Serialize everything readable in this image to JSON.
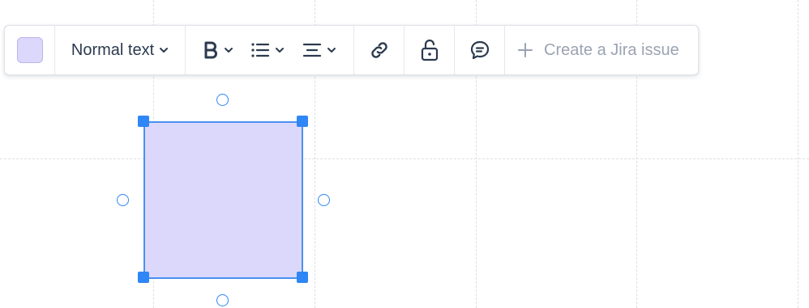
{
  "toolbar": {
    "color_swatch": {
      "icon": "color-swatch",
      "color": "#dcd8fb"
    },
    "text_style": {
      "label": "Normal text",
      "icon": "chevron-down-icon"
    },
    "bold": {
      "icon": "bold-icon"
    },
    "list": {
      "icon": "bulleted-list-icon"
    },
    "align": {
      "icon": "text-align-icon"
    },
    "link": {
      "icon": "link-icon"
    },
    "lock": {
      "icon": "unlocked-icon"
    },
    "comment": {
      "icon": "comment-icon"
    },
    "create_issue": {
      "label": "Create a Jira issue",
      "icon": "plus-icon"
    }
  },
  "canvas": {
    "shape": {
      "type": "rectangle",
      "fill": "#dcd8fb",
      "stroke": "#4a90f0",
      "selected": true
    },
    "handle_color": "#2f86f6"
  }
}
